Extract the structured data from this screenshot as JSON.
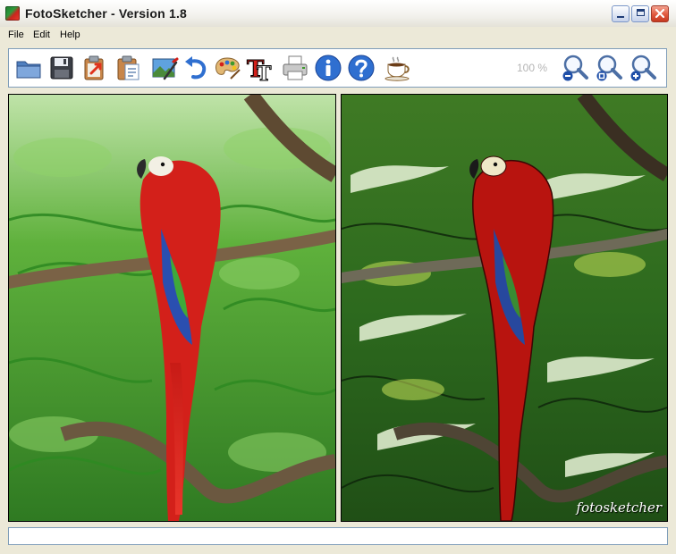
{
  "window": {
    "title": "FotoSketcher - Version 1.8",
    "controls": {
      "minimize": "minimize",
      "maximize": "maximize",
      "close": "close"
    }
  },
  "menu": {
    "items": [
      "File",
      "Edit",
      "Help"
    ]
  },
  "toolbar": {
    "tools": [
      {
        "icon": "open-folder-icon"
      },
      {
        "icon": "save-disk-icon"
      },
      {
        "icon": "copy-to-clipboard-icon"
      },
      {
        "icon": "paste-from-clipboard-icon"
      },
      {
        "icon": "image-effect-icon"
      },
      {
        "icon": "undo-arrow-icon"
      },
      {
        "icon": "palette-icon"
      },
      {
        "icon": "text-tool-icon"
      },
      {
        "icon": "printer-icon"
      },
      {
        "icon": "info-icon"
      },
      {
        "icon": "help-icon"
      },
      {
        "icon": "coffee-cup-icon"
      },
      {
        "icon": "zoom-out-icon"
      },
      {
        "icon": "zoom-reset-icon"
      },
      {
        "icon": "zoom-in-icon"
      }
    ],
    "zoom_level": "100 %",
    "text_tool_glyph": "T"
  },
  "panes": {
    "original": {
      "description_icon": "original-photo"
    },
    "sketch": {
      "watermark": "fotosketcher"
    }
  },
  "status": {
    "text": ""
  },
  "colors": {
    "accent_blue": "#2f6fd0",
    "parrot_red": "#d3201a",
    "foliage_green": "#3f9a2c"
  }
}
